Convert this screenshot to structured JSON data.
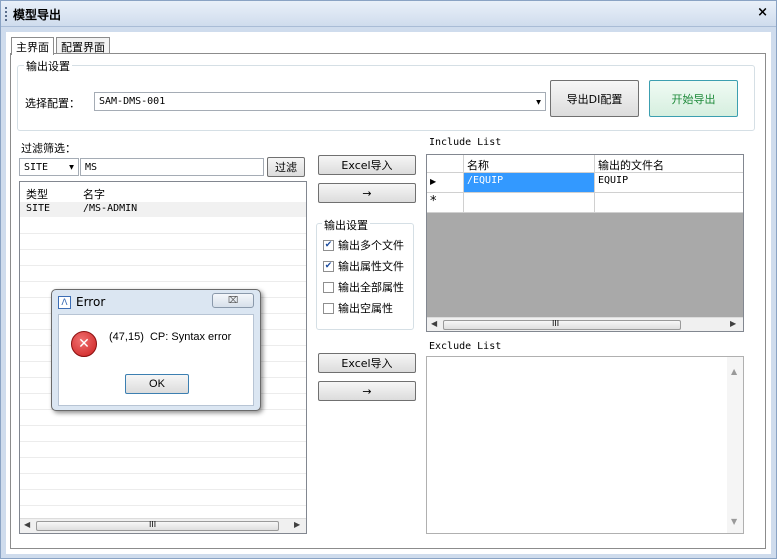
{
  "window": {
    "title": "模型导出",
    "close_label": "×"
  },
  "tabs": [
    {
      "label": "主界面"
    },
    {
      "label": "配置界面"
    }
  ],
  "output_settings": {
    "legend": "输出设置",
    "config_label": "选择配置：",
    "config_value": "SAM-DMS-001",
    "export_di_button": "导出DI配置",
    "start_export_button": "开始导出"
  },
  "filter": {
    "legend": "过滤筛选：",
    "type_value": "SITE",
    "text_value": "MS",
    "filter_button": "过滤",
    "columns": [
      "类型",
      "名字"
    ],
    "rows": [
      {
        "type": "SITE",
        "name": "/MS-ADMIN"
      }
    ]
  },
  "middle": {
    "excel_import_1": "Excel导入",
    "arrow_1": "→",
    "options_legend": "输出设置",
    "options": [
      {
        "label": "输出多个文件",
        "checked": true
      },
      {
        "label": "输出属性文件",
        "checked": true
      },
      {
        "label": "输出全部属性",
        "checked": false
      },
      {
        "label": "输出空属性",
        "checked": false
      }
    ],
    "excel_import_2": "Excel导入",
    "arrow_2": "→"
  },
  "include_list": {
    "legend": "Include List",
    "columns": [
      "名称",
      "输出的文件名"
    ],
    "rows": [
      {
        "name": "/EQUIP",
        "file": "EQUIP"
      }
    ],
    "row_marker": "▶",
    "new_row_marker": "*"
  },
  "exclude_list": {
    "legend": "Exclude List"
  },
  "error_dialog": {
    "title": "Error",
    "message": "(47,15)  CP: Syntax error",
    "ok_label": "OK",
    "close_label": "⌧"
  },
  "scroll": {
    "thumb_mark": "III"
  },
  "colors": {
    "selected": "#3399ff",
    "grid_empty": "#a9a9a9",
    "error_red": "#cc1f1f"
  }
}
